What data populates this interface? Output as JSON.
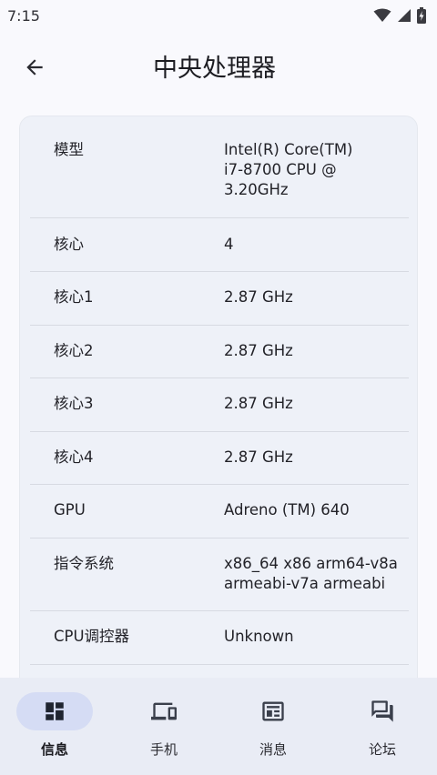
{
  "status_bar": {
    "time": "7:15",
    "icons": [
      "wifi-icon",
      "cellular-signal-icon",
      "battery-charging-icon"
    ]
  },
  "header": {
    "back_icon": "arrow-left-icon",
    "title": "中央处理器"
  },
  "cpu_info": {
    "rows": [
      {
        "label": "模型",
        "value": "Intel(R) Core(TM)\ni7-8700 CPU @\n3.20GHz"
      },
      {
        "label": "核心",
        "value": "4"
      },
      {
        "label": "核心1",
        "value": "2.87 GHz"
      },
      {
        "label": "核心2",
        "value": "2.87 GHz"
      },
      {
        "label": "核心3",
        "value": "2.87 GHz"
      },
      {
        "label": "核心4",
        "value": "2.87 GHz"
      },
      {
        "label": "GPU",
        "value": "Adreno (TM) 640"
      },
      {
        "label": "指令系统",
        "value": "x86_64 x86 arm64-v8a\narmeabi-v7a armeabi"
      },
      {
        "label": "CPU调控器",
        "value": "Unknown"
      }
    ]
  },
  "bottom_nav": {
    "selected": "信息",
    "items": [
      {
        "label": "信息",
        "icon": "dashboard-icon"
      },
      {
        "label": "手机",
        "icon": "devices-icon"
      },
      {
        "label": "消息",
        "icon": "newspaper-icon"
      },
      {
        "label": "论坛",
        "icon": "forum-icon"
      }
    ]
  },
  "colors": {
    "background": "#f9f9fd",
    "card": "#eef1f8",
    "divider": "#d7dae2",
    "nav_background": "#e9ecf5",
    "nav_selected_pill": "#d5dcf4"
  }
}
